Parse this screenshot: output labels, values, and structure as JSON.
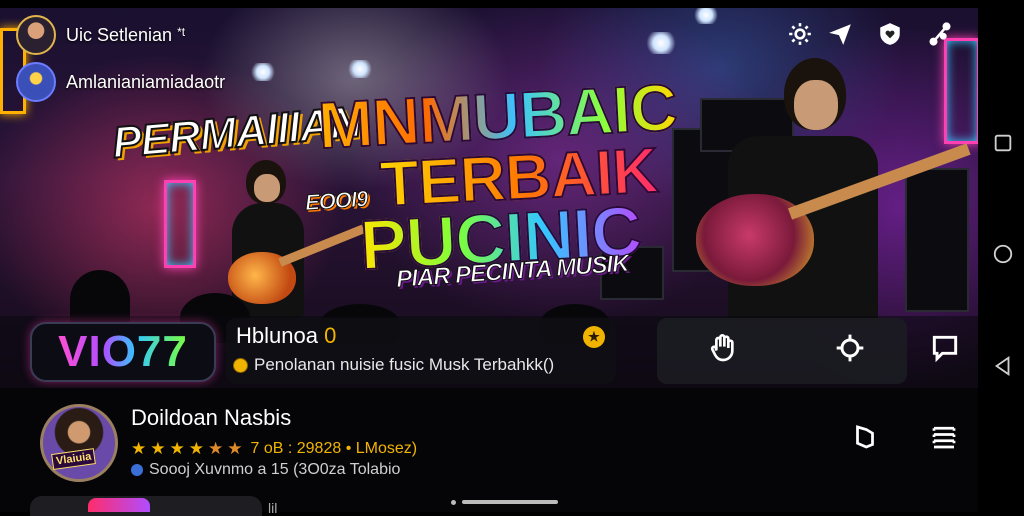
{
  "banner": {
    "title_line1": "PERMAIIIAN",
    "title_line2": "MNMUBAIC",
    "title_line3": "TERBAIK",
    "title_line4": "PUCINIC",
    "badge": "EOOI9",
    "subtitle": "PIAR PECINTA MUSIK"
  },
  "users": [
    {
      "name": "Uic Setlenian",
      "suffix": "*t"
    },
    {
      "name": "Amlanianiamiadaotr",
      "suffix": ""
    }
  ],
  "top_icons": [
    "settings-icon",
    "send-icon",
    "shield-heart-icon",
    "share-icon"
  ],
  "info": {
    "logo": "VIO77",
    "title": "Hblunoa",
    "title_badge": "0",
    "subtitle": "Penolanan nuisie fusic Musk Terbahkk()"
  },
  "actions": [
    "hand-icon",
    "settings-icon",
    "comment-icon"
  ],
  "track": {
    "avatar_label": "Vlaiuia",
    "title": "Doildoan Nasbis",
    "stars_full": 4,
    "stars_half": 2,
    "rating_text": "7 oB : 29828 • LMosez)",
    "meta": "Soooj Xuvnmo a 15 (3O0za Tolabio"
  },
  "next": {
    "peek_text": "lil"
  },
  "colors": {
    "accent_gold": "#f2b400",
    "neon_pink": "#ff3fb2",
    "neon_blue": "#33c8ff"
  }
}
